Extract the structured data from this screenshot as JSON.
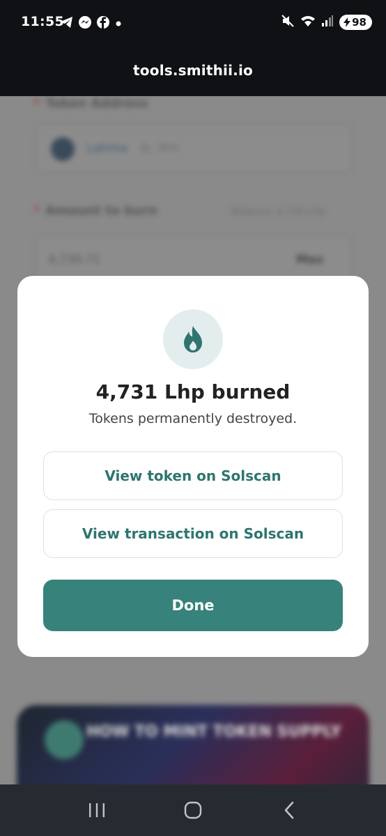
{
  "status_bar": {
    "time": "11:55",
    "battery": "98",
    "left_icons": [
      "telegram-icon",
      "messenger-icon",
      "facebook-icon",
      "dot-icon"
    ],
    "right_icons": [
      "mute-icon",
      "wifi-icon",
      "signal-icon",
      "battery-charging-icon"
    ]
  },
  "browser": {
    "url": "tools.smithii.io"
  },
  "background_page": {
    "token_address_label": "Token Address",
    "token_name": "Lahma",
    "token_short_address": "9J...WHr",
    "amount_label": "Amount to burn",
    "balance_text": "Balance: 4,730 Lhp",
    "amount_value": "4,730.71",
    "max_label": "Max",
    "video_title": "HOW TO MINT TOKEN SUPPLY"
  },
  "modal": {
    "icon": "flame-icon",
    "title": "4,731 Lhp burned",
    "subtitle": "Tokens permanently destroyed.",
    "view_token_label": "View token on Solscan",
    "view_tx_label": "View transaction on Solscan",
    "done_label": "Done"
  },
  "nav_bar": {
    "icons": [
      "recent-apps-icon",
      "home-icon",
      "back-icon"
    ]
  },
  "colors": {
    "accent": "#37827a",
    "accent_text": "#2e7570",
    "icon_bg": "#e3eded"
  }
}
